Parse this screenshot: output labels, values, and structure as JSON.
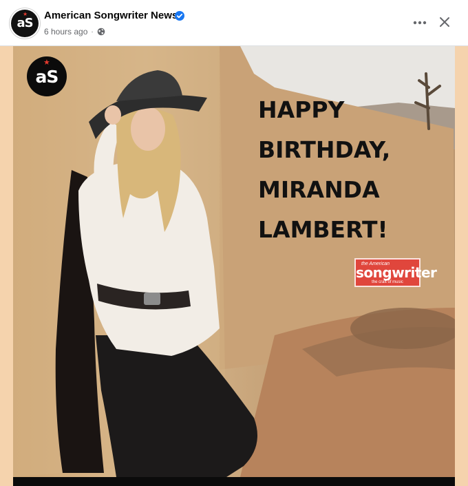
{
  "post": {
    "page_name": "American Songwriter News",
    "timestamp": "6 hours ago",
    "separator": "·",
    "avatar_text": "aS",
    "privacy_icon": "globe-icon",
    "verified_icon": "verified-badge-icon",
    "more_icon": "more-options-icon",
    "close_icon": "close-icon"
  },
  "image": {
    "logo_badge_text": "aS",
    "headline_lines": [
      "HAPPY",
      "BIRTHDAY,",
      "MIRANDA",
      "LAMBERT!"
    ],
    "brand_logo": {
      "small": "the American",
      "big": "songwriter",
      "tagline": "the craft of music"
    }
  },
  "colors": {
    "brand_red": "#e0463c",
    "verified_blue": "#1877f2",
    "frame_peach": "#f5d3ad",
    "headline_text": "#111111"
  }
}
